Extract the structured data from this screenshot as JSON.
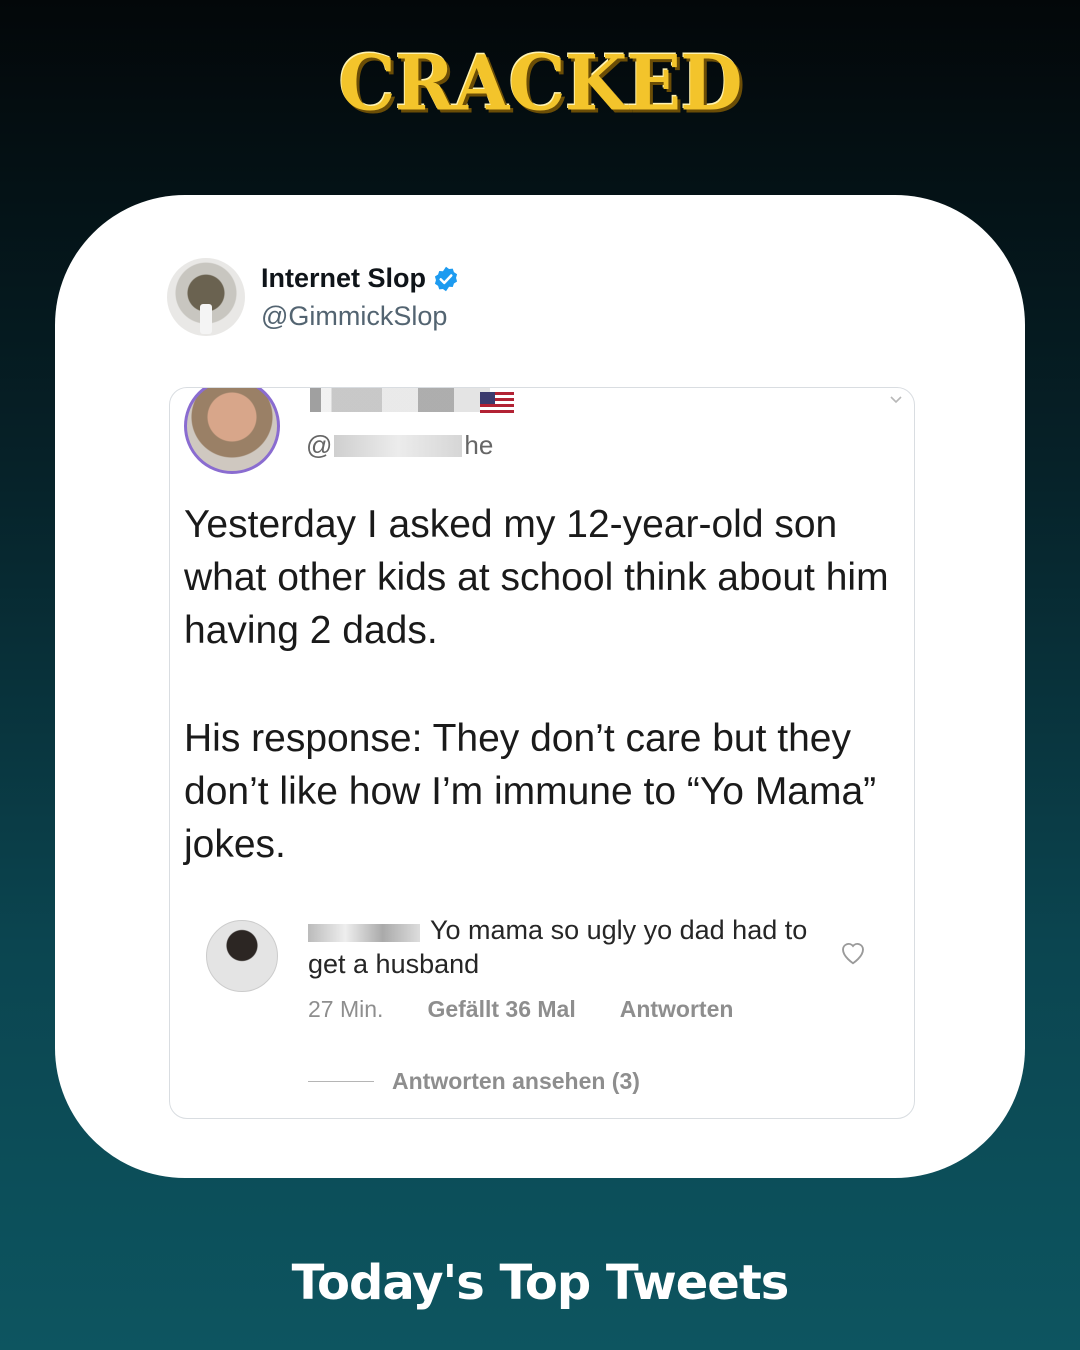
{
  "brand": {
    "logo": "CRACKED",
    "color": "#f3c42b"
  },
  "author": {
    "name": "Internet Slop",
    "handle": "@GimmickSlop",
    "verified_icon": "verified-badge-icon",
    "verified_color": "#1d9bf0"
  },
  "embedded": {
    "poster_handle_start": "@",
    "poster_handle_end": "he",
    "tweet_paragraphs": [
      "Yesterday I asked my 12-year-old son what other kids at school think about him having 2 dads.",
      "His response: They don’t care but they don’t like how I’m immune to “Yo Mama” jokes."
    ],
    "comment": {
      "text": "Yo mama so ugly yo dad had to get a husband",
      "time": "27 Min.",
      "likes": "Gefällt 36 Mal",
      "reply": "Antworten",
      "view_replies": "Antworten ansehen (3)"
    }
  },
  "footer": {
    "title": "Today's Top Tweets"
  }
}
